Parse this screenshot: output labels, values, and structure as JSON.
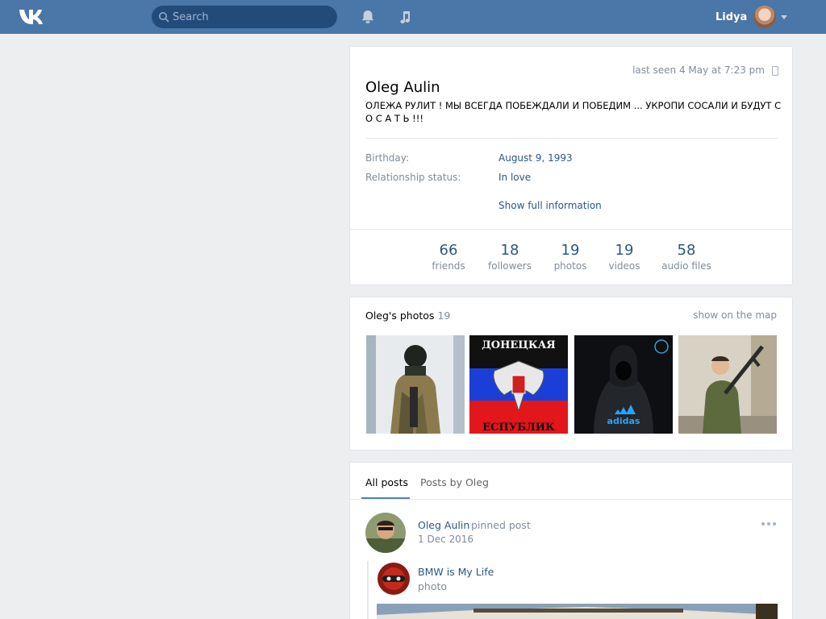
{
  "header": {
    "search_placeholder": "Search",
    "user_name": "Lidya",
    "brand_color": "#4a76a8"
  },
  "profile": {
    "last_seen": "last seen 4 May at 7:23 pm",
    "name": "Oleg Aulin",
    "status": "ОЛЕЖА РУЛИТ ! МЫ ВСЕГДА ПОБЕЖДАЛИ И ПОБЕДИМ ... УКРОПИ СОСАЛИ И БУДУТ С О С А Т Ь !!!",
    "info": [
      {
        "label": "Birthday:",
        "value": "August 9, 1993"
      },
      {
        "label": "Relationship status:",
        "value": "In love"
      }
    ],
    "show_full": "Show full information",
    "counters": [
      {
        "num": "66",
        "label": "friends"
      },
      {
        "num": "18",
        "label": "followers"
      },
      {
        "num": "19",
        "label": "photos"
      },
      {
        "num": "19",
        "label": "videos"
      },
      {
        "num": "58",
        "label": "audio files"
      }
    ]
  },
  "photos": {
    "title": "Oleg's photos",
    "count": "19",
    "map_link": "show on the map",
    "flag_top_text": "ДОНЕЦКАЯ",
    "flag_bottom_text": "ЕСПУБЛИК",
    "adidas_text": "adidas"
  },
  "wall": {
    "tabs": [
      "All posts",
      "Posts by Oleg"
    ],
    "post": {
      "author": "Oleg Aulin",
      "pinned": "pinned post",
      "date": "1 Dec 2016",
      "repost_name": "BMW is My Life",
      "repost_type": "photo"
    }
  }
}
